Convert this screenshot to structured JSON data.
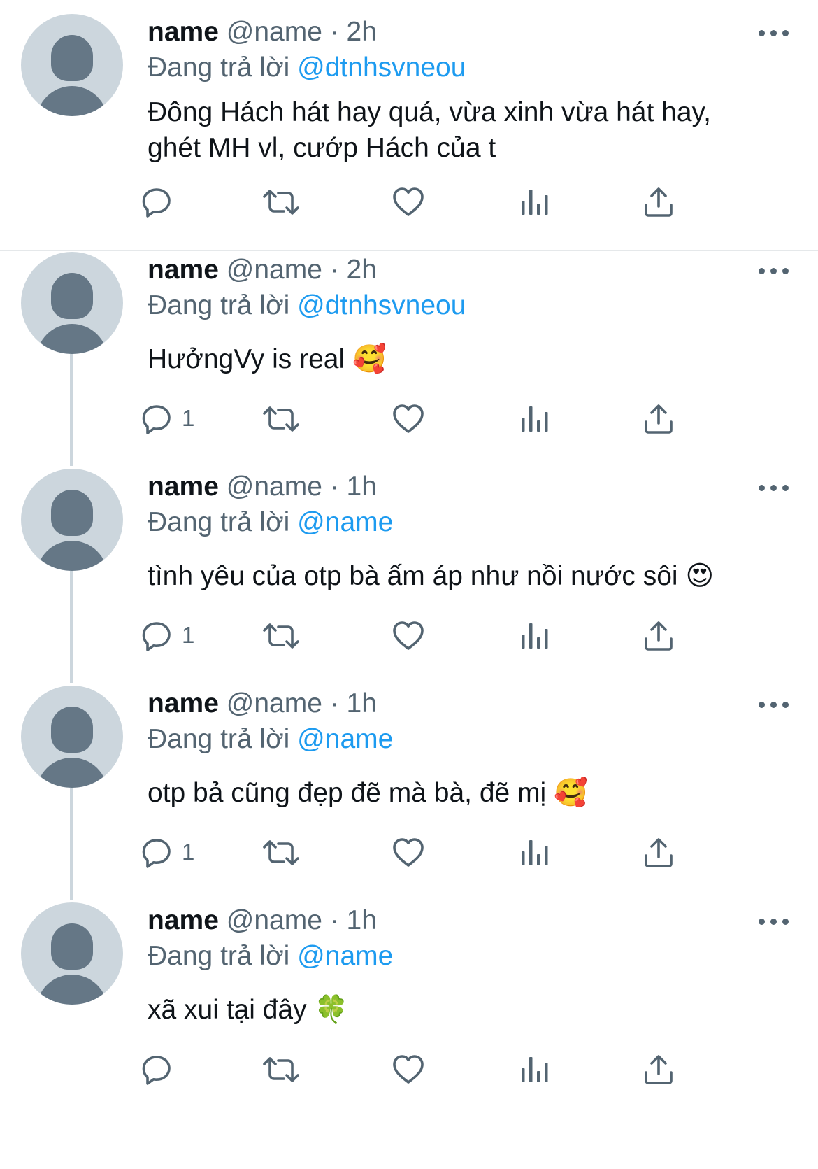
{
  "tweets": [
    {
      "username": "name",
      "handle": "@name",
      "time": "· 2h",
      "replying_label": "Đang trả lời",
      "replying_to": "@dtnhsvneou",
      "text": "Đông Hách hát hay quá, vừa xinh vừa hát hay,",
      "text2": "ghét MH vl, cướp Hách của t",
      "emoji": "",
      "reply_count": ""
    },
    {
      "username": "name",
      "handle": "@name",
      "time": "· 2h",
      "replying_label": "Đang trả lời",
      "replying_to": "@dtnhsvneou",
      "text": "HưởngVy is real",
      "text2": "",
      "emoji": "🥰",
      "reply_count": "1"
    },
    {
      "username": "name",
      "handle": "@name",
      "time": "· 1h",
      "replying_label": "Đang trả lời",
      "replying_to": "@name",
      "text": "tình yêu của otp bà ấm áp như nồi nước sôi",
      "text2": "",
      "emoji": "😍",
      "reply_count": "1"
    },
    {
      "username": "name",
      "handle": "@name",
      "time": "· 1h",
      "replying_label": "Đang trả lời",
      "replying_to": "@name",
      "text": "otp bả cũng đẹp đẽ mà bà, đẽ mị",
      "text2": "",
      "emoji": "🥰",
      "reply_count": "1"
    },
    {
      "username": "name",
      "handle": "@name",
      "time": "· 1h",
      "replying_label": "Đang trả lời",
      "replying_to": "@name",
      "text": "xã xui tại đây",
      "text2": "",
      "emoji": "🍀",
      "reply_count": ""
    }
  ],
  "colors": {
    "accent": "#1d9bf0",
    "secondary_text": "#536471",
    "avatar_bg": "#ccd6dd",
    "avatar_fg": "#657786"
  },
  "icons": [
    "reply-icon",
    "retweet-icon",
    "like-icon",
    "views-icon",
    "share-icon",
    "more-icon"
  ]
}
